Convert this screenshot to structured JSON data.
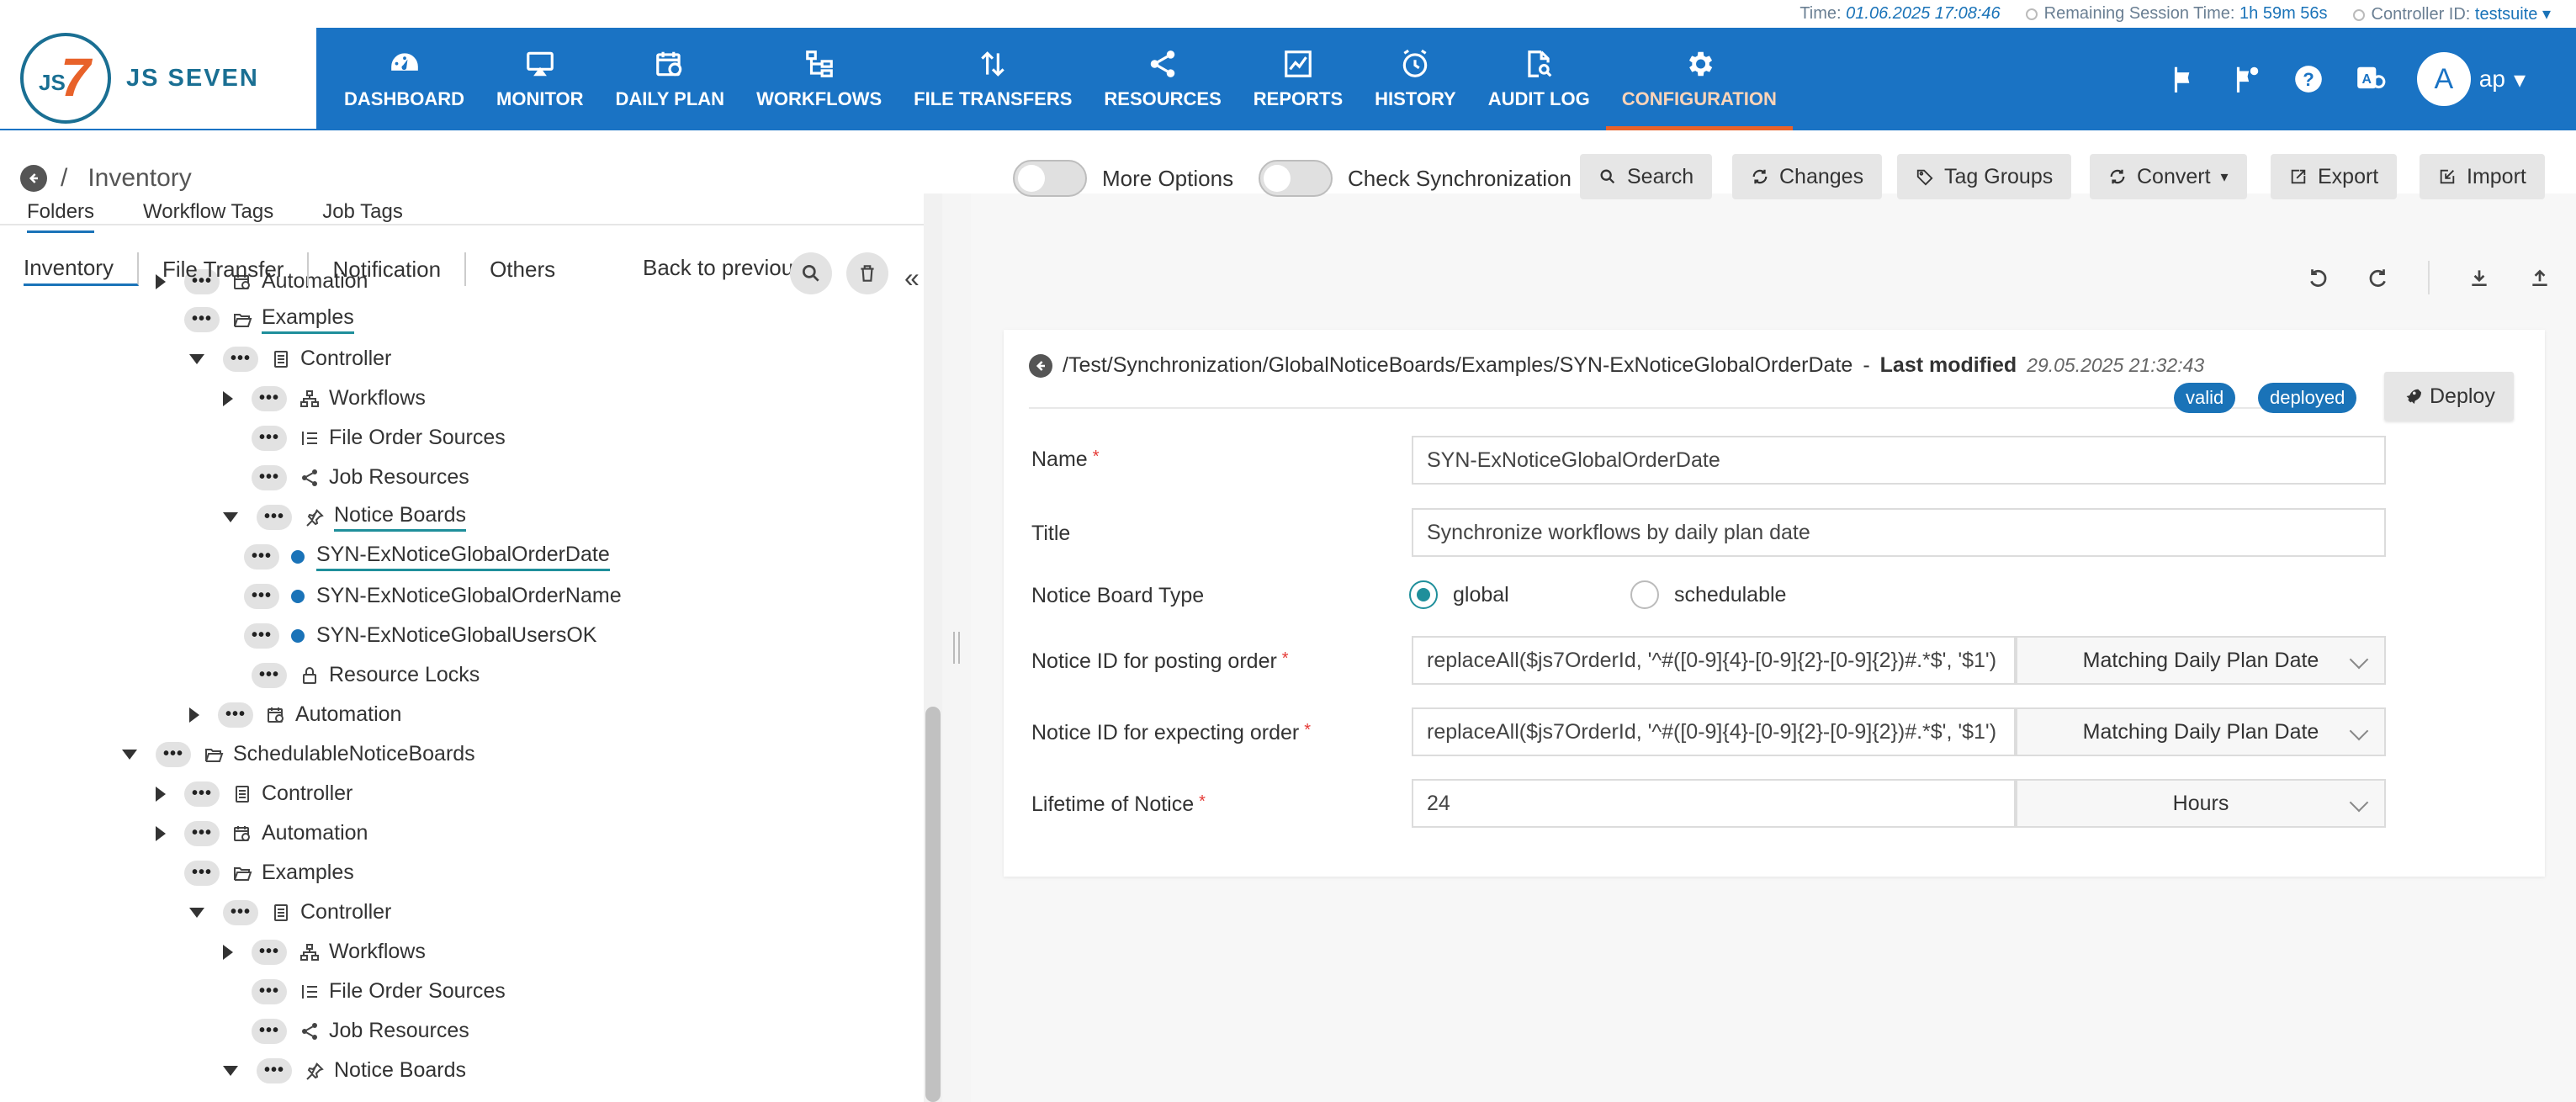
{
  "status": {
    "time_label": "Time:",
    "time_value": "01.06.2025 17:08:46",
    "session_label": "Remaining Session Time:",
    "session_value": "1h 59m 56s",
    "controller_label": "Controller ID:",
    "controller_value": "testsuite"
  },
  "logo": {
    "js": "JS",
    "seven": "7",
    "text": "JS SEVEN"
  },
  "nav": [
    {
      "label": "DASHBOARD",
      "icon": "dashboard-icon"
    },
    {
      "label": "MONITOR",
      "icon": "monitor-icon"
    },
    {
      "label": "DAILY PLAN",
      "icon": "calendar-clock-icon"
    },
    {
      "label": "WORKFLOWS",
      "icon": "workflow-icon"
    },
    {
      "label": "FILE TRANSFERS",
      "icon": "transfer-arrows-icon"
    },
    {
      "label": "RESOURCES",
      "icon": "share-icon"
    },
    {
      "label": "REPORTS",
      "icon": "line-chart-icon"
    },
    {
      "label": "HISTORY",
      "icon": "alarm-clock-icon"
    },
    {
      "label": "AUDIT LOG",
      "icon": "document-search-icon"
    },
    {
      "label": "CONFIGURATION",
      "icon": "gear-icon"
    }
  ],
  "user": {
    "initial": "A",
    "name": "ap"
  },
  "breadcrumb": {
    "sep": "/",
    "title": "Inventory"
  },
  "subtabs": [
    "Folders",
    "Workflow Tags",
    "Job Tags"
  ],
  "lowtabs": [
    "Inventory",
    "File Transfer",
    "Notification",
    "Others"
  ],
  "back_prev": "Back to previous object",
  "tree": [
    {
      "label": "Automation",
      "icon": "calendar-clock-icon",
      "level": 2,
      "toggle": "right"
    },
    {
      "label": "Examples",
      "icon": "folder-open-icon",
      "level": 2,
      "toggle": "none",
      "selected": true
    },
    {
      "label": "Controller",
      "icon": "controller-doc-icon",
      "level": 3,
      "toggle": "down"
    },
    {
      "label": "Workflows",
      "icon": "workflow-icon",
      "level": 4,
      "toggle": "right"
    },
    {
      "label": "File Order Sources",
      "icon": "list-icon",
      "level": 4,
      "toggle": "none"
    },
    {
      "label": "Job Resources",
      "icon": "share-icon",
      "level": 4,
      "toggle": "none"
    },
    {
      "label": "Notice Boards",
      "icon": "pin-icon",
      "level": 4,
      "toggle": "down",
      "selected": true
    },
    {
      "label": "SYN-ExNoticeGlobalOrderDate",
      "icon": "dot",
      "level": 5,
      "toggle": "none",
      "selected": true
    },
    {
      "label": "SYN-ExNoticeGlobalOrderName",
      "icon": "dot",
      "level": 5,
      "toggle": "none"
    },
    {
      "label": "SYN-ExNoticeGlobalUsersOK",
      "icon": "dot",
      "level": 5,
      "toggle": "none"
    },
    {
      "label": "Resource Locks",
      "icon": "lock-icon",
      "level": 4,
      "toggle": "none"
    },
    {
      "label": "Automation",
      "icon": "calendar-clock-icon",
      "level": 3,
      "toggle": "right"
    },
    {
      "label": "SchedulableNoticeBoards",
      "icon": "folder-open-icon",
      "level": 1,
      "toggle": "down"
    },
    {
      "label": "Controller",
      "icon": "controller-doc-icon",
      "level": 2,
      "toggle": "right"
    },
    {
      "label": "Automation",
      "icon": "calendar-clock-icon",
      "level": 2,
      "toggle": "right"
    },
    {
      "label": "Examples",
      "icon": "folder-open-icon",
      "level": 2,
      "toggle": "none"
    },
    {
      "label": "Controller",
      "icon": "controller-doc-icon",
      "level": 3,
      "toggle": "down"
    },
    {
      "label": "Workflows",
      "icon": "workflow-icon",
      "level": 4,
      "toggle": "right"
    },
    {
      "label": "File Order Sources",
      "icon": "list-icon",
      "level": 4,
      "toggle": "none"
    },
    {
      "label": "Job Resources",
      "icon": "share-icon",
      "level": 4,
      "toggle": "none"
    },
    {
      "label": "Notice Boards",
      "icon": "pin-icon",
      "level": 4,
      "toggle": "down"
    }
  ],
  "toolbar": {
    "more_options": "More Options",
    "check_sync": "Check Synchronization",
    "search": "Search",
    "changes": "Changes",
    "tag_groups": "Tag Groups",
    "convert": "Convert",
    "export": "Export",
    "import": "Import"
  },
  "detail": {
    "path": "/Test/Synchronization/GlobalNoticeBoards/Examples/SYN-ExNoticeGlobalOrderDate",
    "dash": "-",
    "last_modified_label": "Last modified",
    "last_modified_value": "29.05.2025 21:32:43",
    "badge_valid": "valid",
    "badge_deployed": "deployed",
    "deploy": "Deploy",
    "name_label": "Name",
    "name_value": "SYN-ExNoticeGlobalOrderDate",
    "title_label": "Title",
    "title_value": "Synchronize workflows by daily plan date",
    "type_label": "Notice Board Type",
    "type_global": "global",
    "type_schedulable": "schedulable",
    "post_label": "Notice ID for posting order",
    "post_value": "replaceAll($js7OrderId, '^#([0-9]{4}-[0-9]{2}-[0-9]{2})#.*$', '$1')",
    "post_select": "Matching Daily Plan Date",
    "expect_label": "Notice ID for expecting order",
    "expect_value": "replaceAll($js7OrderId, '^#([0-9]{4}-[0-9]{2}-[0-9]{2})#.*$', '$1')",
    "expect_select": "Matching Daily Plan Date",
    "lifetime_label": "Lifetime of Notice",
    "lifetime_value": "24",
    "lifetime_unit": "Hours",
    "required_mark": "*"
  }
}
